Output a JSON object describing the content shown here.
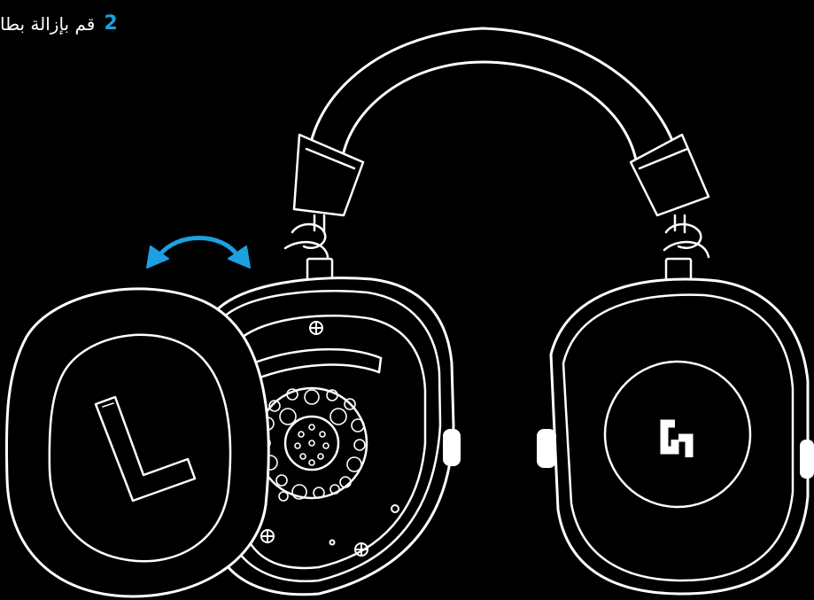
{
  "step": {
    "number": "2",
    "text": "قم بإزالة بطا"
  },
  "illustration": {
    "earcup_marking": "L",
    "logo": "G",
    "icons": [
      "rotate-arrow-icon",
      "screw-icon",
      "logitech-g-logo-icon"
    ]
  },
  "colors": {
    "background": "#000000",
    "line": "#ffffff",
    "accent": "#1ba1e2"
  }
}
